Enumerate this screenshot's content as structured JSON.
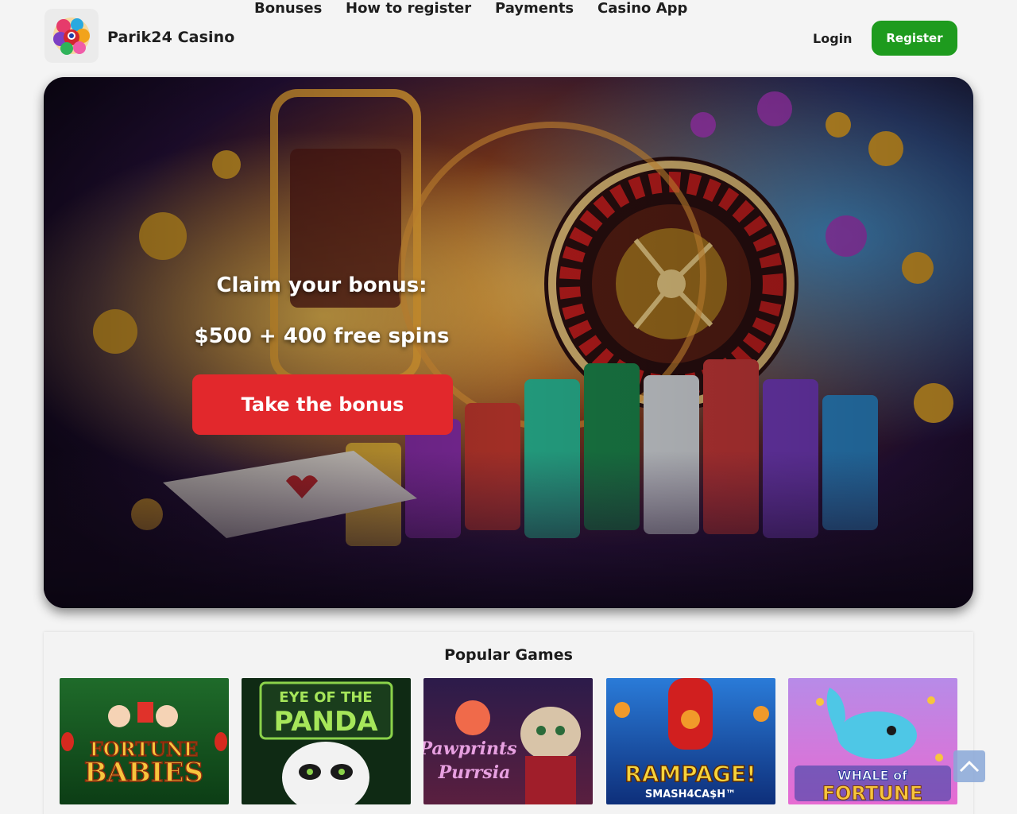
{
  "header": {
    "brand": "Parik24 Casino",
    "logo_icon": "colorful-spheres-logo",
    "nav": [
      {
        "label": "Bonuses"
      },
      {
        "label": "How to register"
      },
      {
        "label": "Payments"
      },
      {
        "label": "Casino App"
      }
    ],
    "login_label": "Login",
    "register_label": "Register",
    "accent": "#1e9b1e"
  },
  "hero": {
    "title": "Claim your bonus:",
    "subtitle": "$500 + 400 free spins",
    "cta_label": "Take the bonus",
    "cta_color": "#e2282c"
  },
  "games": {
    "title": "Popular Games",
    "items": [
      {
        "line1": "FORTUNE",
        "line2": "BABIES"
      },
      {
        "line1": "EYE OF THE",
        "line2": "PANDA"
      },
      {
        "line1": "Pawprints",
        "line2": "Purrsia"
      },
      {
        "line1": "RAMPAGE!",
        "line2": "SMASH4CA$H™"
      },
      {
        "line1": "WHALE of",
        "line2": "FORTUNE"
      }
    ]
  },
  "scroll_top_icon": "chevron-up-icon"
}
